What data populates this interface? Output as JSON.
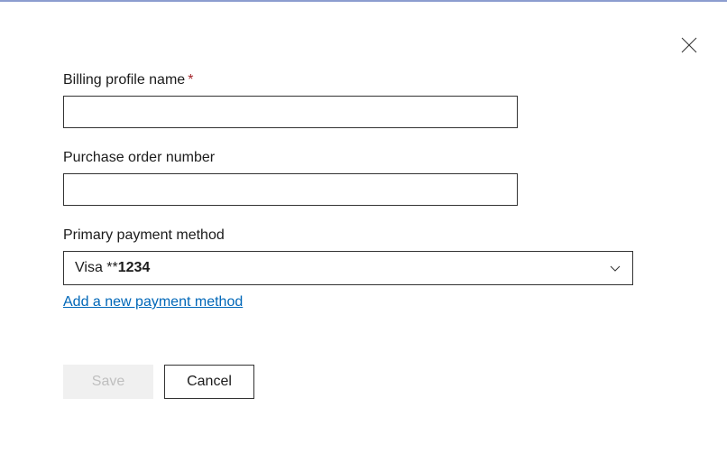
{
  "close": {
    "name": "close"
  },
  "fields": {
    "billing_profile": {
      "label": "Billing profile name",
      "required_mark": "*",
      "value": ""
    },
    "purchase_order": {
      "label": "Purchase order number",
      "value": ""
    },
    "payment_method": {
      "label": "Primary payment method",
      "selected_prefix": "Visa **",
      "selected_digits": "1234",
      "add_link": "Add a new payment method"
    }
  },
  "buttons": {
    "save": "Save",
    "cancel": "Cancel"
  }
}
